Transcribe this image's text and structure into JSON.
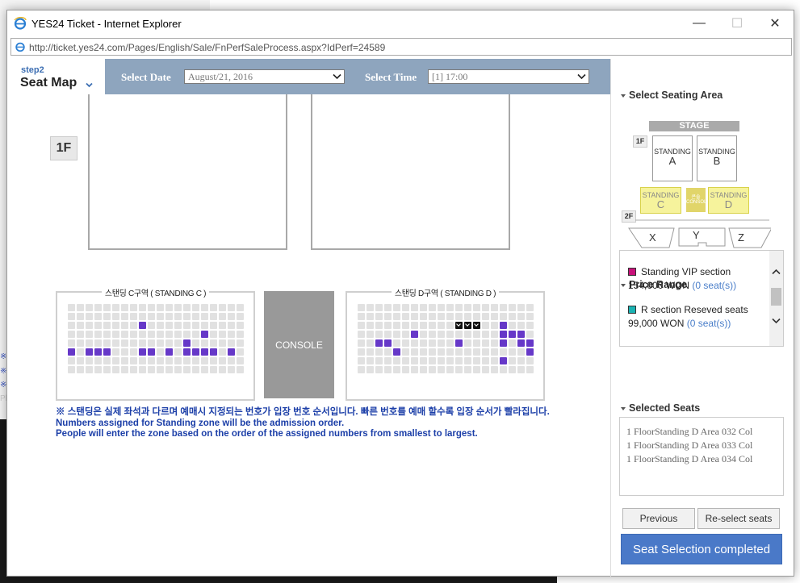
{
  "background": {
    "fragments": [
      "※",
      "※",
      "※",
      "Pl"
    ]
  },
  "window": {
    "title": "YES24 Ticket - Internet Explorer",
    "address": "http://ticket.yes24.com/Pages/English/Sale/FnPerfSaleProcess.aspx?IdPerf=24589",
    "controls": {
      "minimize": "—",
      "maximize": "☐",
      "close": "✕"
    }
  },
  "nav": {
    "step": "step2",
    "title": "Seat Map"
  },
  "selection_bar": {
    "date_label": "Select Date",
    "date_value": "August/21, 2016",
    "time_label": "Select Time",
    "time_value": "[1] 17:00"
  },
  "seat_map": {
    "floor_badge": "1F",
    "zone_c_title": "스탠딩 C구역 ( STANDING C )",
    "zone_d_title": "스탠딩 D구역 ( STANDING D )",
    "console_label": "CONSOLE",
    "zone_c_grid": [
      "....................",
      "....................",
      "........P...........",
      "...............P....",
      ".............P......",
      "P.PPP...PP.P.PPPP.P.",
      "....................",
      "...................."
    ],
    "zone_d_grid": [
      "....................",
      "....................",
      "...........XXX..P...",
      "......P.........PPP.",
      "..PP.......P....P.PP",
      "....P..............P",
      "................P...",
      "...................."
    ],
    "colors": {
      "available": "#e1e1e1",
      "taken": "#6638c8",
      "selected": "#111111"
    },
    "notice_lines": [
      "※ 스탠딩은 실제 좌석과 다르며 예매시 지정되는 번호가 입장 번호 순서입니다. 빠른 번호를 예매 할수록 입장 순서가 빨라집니다.",
      "Numbers assigned for Standing zone will be the admission order.",
      "People will enter the zone based on the order of the assigned numbers from smallest to largest."
    ]
  },
  "right_panel": {
    "seating_area_heading": "Select Seating Area",
    "mini_map": {
      "stage": "STAGE",
      "floor1": "1F",
      "floor2": "2F",
      "standing_label": "STANDING",
      "blocks": [
        "A",
        "B",
        "C",
        "D"
      ],
      "console": "콘솔 CONSOLE",
      "upper": [
        "X",
        "Y",
        "Z"
      ]
    },
    "price_heading": "Price Range",
    "prices": [
      {
        "name": "Standing VIP section",
        "price": "154,000 WON",
        "count": "(0 seat(s))",
        "color": "#c8117a"
      },
      {
        "name": "R section Reseved seats",
        "price": "99,000 WON",
        "count": "(0 seat(s))",
        "color": "#1ab3b3"
      }
    ],
    "selected_heading": "Selected Seats",
    "selected_seats": [
      "1 FloorStanding D Area 032 Col",
      "1 FloorStanding D Area 033 Col",
      "1 FloorStanding D Area 034 Col"
    ],
    "previous_label": "Previous",
    "reselect_label": "Re-select seats",
    "complete_label": "Seat Selection completed"
  }
}
